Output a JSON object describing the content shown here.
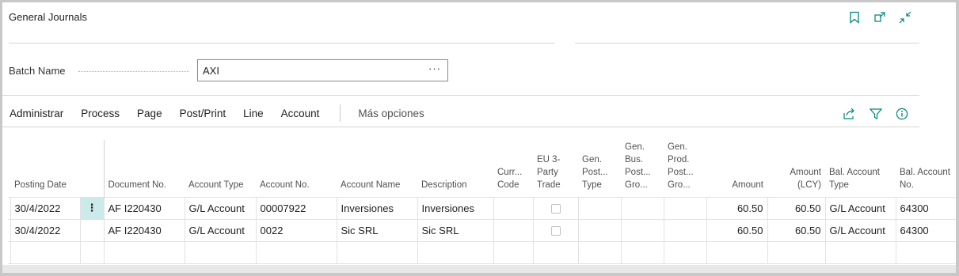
{
  "page": {
    "title": "General Journals"
  },
  "batch": {
    "label": "Batch Name",
    "value": "AXI",
    "more": "···"
  },
  "top_icons": [
    "bookmark-icon",
    "open-in-new-window-icon",
    "collapse-icon"
  ],
  "menu": {
    "items": [
      "Administrar",
      "Process",
      "Page",
      "Post/Print",
      "Line",
      "Account"
    ],
    "more": "Más opciones"
  },
  "action_icons": [
    "share-icon",
    "filter-icon",
    "info-icon"
  ],
  "colors": {
    "accent": "#00857a",
    "selected_cell": "#cdeaea"
  },
  "table": {
    "headers": {
      "posting_date": "Posting Date",
      "document_no": "Document No.",
      "account_type": "Account Type",
      "account_no": "Account No.",
      "account_name": "Account Name",
      "description": "Description",
      "curr_code": "Curr... Code",
      "eu_3party": "EU 3-Party Trade",
      "gen_post_type": "Gen. Post... Type",
      "gen_bus_post_group": "Gen. Bus. Post... Gro...",
      "gen_prod_post_group": "Gen. Prod. Post... Gro...",
      "amount": "Amount",
      "amount_lcy": "Amount (LCY)",
      "bal_account_type": "Bal. Account Type",
      "bal_account_no": "Bal. Account No."
    },
    "rows": [
      {
        "posting_date": "30/4/2022",
        "row_action": "⋮",
        "document_no": "AF I220430",
        "account_type": "G/L Account",
        "account_no": "00007922",
        "account_name": "Inversiones",
        "description": "Inversiones",
        "amount": "60.50",
        "amount_lcy": "60.50",
        "bal_account_type": "G/L Account",
        "bal_account_no": "64300"
      },
      {
        "posting_date": "30/4/2022",
        "document_no": "AF I220430",
        "account_type": "G/L Account",
        "account_no": "0022",
        "account_name": "Sic SRL",
        "description": "Sic SRL",
        "amount": "60.50",
        "amount_lcy": "60.50",
        "bal_account_type": "G/L Account",
        "bal_account_no": "64300"
      }
    ]
  }
}
